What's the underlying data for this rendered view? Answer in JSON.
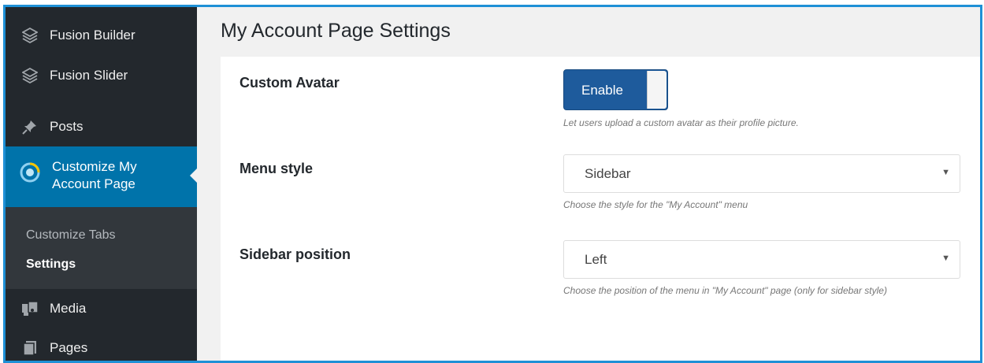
{
  "sidebar": {
    "items": [
      {
        "label": "Fusion Builder",
        "icon": "fusion-builder-icon"
      },
      {
        "label": "Fusion Slider",
        "icon": "fusion-slider-icon"
      },
      {
        "label": "Posts",
        "icon": "pushpin-icon"
      },
      {
        "label": "Customize My Account Page",
        "icon": "account-page-icon"
      },
      {
        "label": "Media",
        "icon": "media-icon"
      },
      {
        "label": "Pages",
        "icon": "pages-icon"
      }
    ],
    "submenu": [
      {
        "label": "Customize Tabs"
      },
      {
        "label": "Settings"
      }
    ],
    "active_color": "#0073aa",
    "background_color": "#23282d"
  },
  "page": {
    "title": "My Account Page Settings"
  },
  "settings": {
    "custom_avatar": {
      "label": "Custom Avatar",
      "toggle_text": "Enable",
      "enabled": true,
      "description": "Let users upload a custom avatar as their profile picture."
    },
    "menu_style": {
      "label": "Menu style",
      "value": "Sidebar",
      "description": "Choose the style for the \"My Account\" menu"
    },
    "sidebar_position": {
      "label": "Sidebar position",
      "value": "Left",
      "description": "Choose the position of the menu in \"My Account\" page (only for sidebar style)"
    }
  },
  "colors": {
    "frame_border": "#1e90d6",
    "toggle_on": "#1e5b9c"
  }
}
